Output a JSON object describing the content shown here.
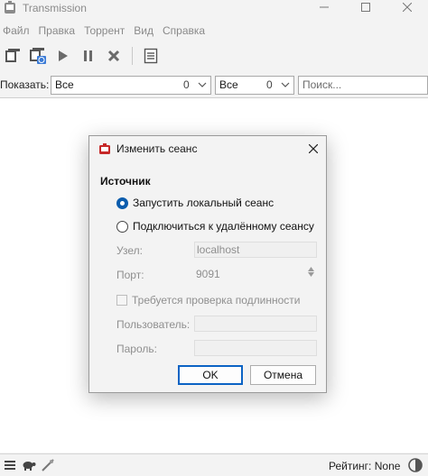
{
  "window": {
    "title": "Transmission",
    "controls": {
      "minimize_icon": "minimize-icon",
      "maximize_icon": "maximize-icon",
      "close_icon": "close-icon"
    }
  },
  "menu": [
    "Файл",
    "Правка",
    "Торрент",
    "Вид",
    "Справка"
  ],
  "toolbar": {
    "buttons": [
      "open-torrent-icon",
      "open-url-icon",
      "start-icon",
      "pause-icon",
      "remove-icon",
      "properties-icon"
    ]
  },
  "filter": {
    "label": "Показать:",
    "activity": {
      "value": "Все",
      "count": "0"
    },
    "tracker": {
      "value": "Все",
      "count": "0"
    },
    "search_placeholder": "Поиск..."
  },
  "statusbar": {
    "icons": [
      "options-icon",
      "turtle-icon",
      "compact-view-icon"
    ],
    "ratio": "Рейтинг: None"
  },
  "dialog": {
    "title": "Изменить сеанс",
    "section": "Источник",
    "options": {
      "local": "Запустить локальный сеанс",
      "remote": "Подключиться к удалённому сеансу",
      "selected": "local"
    },
    "fields": {
      "host_label": "Узел:",
      "host_value": "localhost",
      "port_label": "Порт:",
      "port_value": "9091",
      "auth_label": "Требуется проверка подлинности",
      "user_label": "Пользователь:",
      "user_value": "",
      "pass_label": "Пароль:",
      "pass_value": ""
    },
    "buttons": {
      "ok": "OK",
      "cancel": "Отмена"
    }
  },
  "colors": {
    "accent": "#0b5cad",
    "app_icon": "#c62828",
    "toolbar_icon": "#5a5a5a"
  }
}
